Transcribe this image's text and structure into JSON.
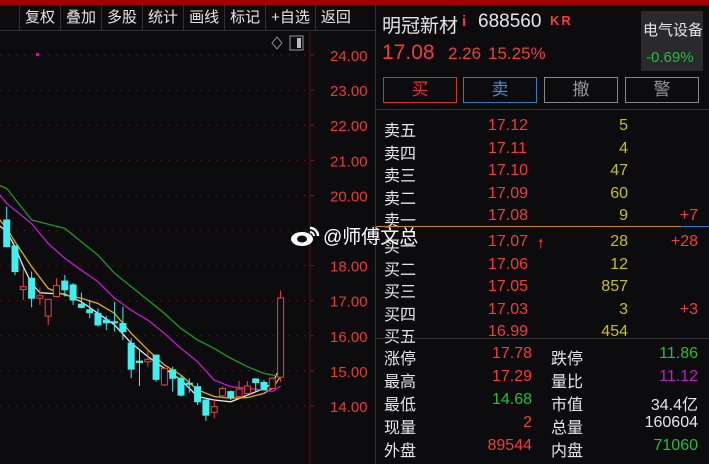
{
  "toolbar": [
    "复权",
    "叠加",
    "多股",
    "统计",
    "画线",
    "标记",
    "+自选",
    "返回"
  ],
  "stock": {
    "name": "明冠新材",
    "info_mark": "i",
    "code": "688560",
    "tag": "KR",
    "price": "17.08",
    "change": "2.26",
    "pct": "15.25%"
  },
  "sector": {
    "name": "电气设备",
    "pct": "-0.69%"
  },
  "actions": {
    "buy": "买",
    "sell": "卖",
    "cancel": "撤",
    "alert": "警"
  },
  "asks": [
    {
      "label": "卖五",
      "price": "17.12",
      "vol": "5",
      "chg": ""
    },
    {
      "label": "卖四",
      "price": "17.11",
      "vol": "4",
      "chg": ""
    },
    {
      "label": "卖三",
      "price": "17.10",
      "vol": "47",
      "chg": ""
    },
    {
      "label": "卖二",
      "price": "17.09",
      "vol": "60",
      "chg": ""
    },
    {
      "label": "卖一",
      "price": "17.08",
      "vol": "9",
      "chg": "+7"
    }
  ],
  "bids": [
    {
      "label": "买一",
      "price": "17.07",
      "vol": "28",
      "chg": "+28"
    },
    {
      "label": "买二",
      "price": "17.06",
      "vol": "12",
      "chg": ""
    },
    {
      "label": "买三",
      "price": "17.05",
      "vol": "857",
      "chg": ""
    },
    {
      "label": "买四",
      "price": "17.03",
      "vol": "3",
      "chg": "+3"
    },
    {
      "label": "买五",
      "price": "16.99",
      "vol": "454",
      "chg": ""
    }
  ],
  "stats": [
    {
      "l1": "涨停",
      "v1": "17.78",
      "c1": "red",
      "l2": "跌停",
      "v2": "11.86",
      "c2": "green"
    },
    {
      "l1": "最高",
      "v1": "17.29",
      "c1": "red",
      "l2": "量比",
      "v2": "11.12",
      "c2": "pur"
    },
    {
      "l1": "最低",
      "v1": "14.68",
      "c1": "green",
      "l2": "市值",
      "v2": "34.4亿",
      "c2": "wht"
    },
    {
      "l1": "现量",
      "v1": "2",
      "c1": "red",
      "l2": "总量",
      "v2": "160604",
      "c2": "wht"
    },
    {
      "l1": "外盘",
      "v1": "89544",
      "c1": "red",
      "l2": "内盘",
      "v2": "71060",
      "c2": "green"
    }
  ],
  "watermark": "@师傅文总",
  "colors": {
    "up": "#f23c3c",
    "down": "#3ef0f0",
    "ma5": "#e6e6e6",
    "ma10": "#e0b000",
    "ma20": "#c21cc8",
    "ma30": "#1a9e1a"
  },
  "chart_data": {
    "type": "candlestick",
    "yticks": [
      "24.00",
      "23.00",
      "22.00",
      "21.00",
      "20.00",
      "18.00",
      "17.00",
      "16.00",
      "15.00",
      "14.00"
    ],
    "ylim": [
      13.5,
      24.7
    ],
    "candles": [
      [
        19.3,
        18.54,
        19.68,
        18.52
      ],
      [
        18.56,
        17.83,
        18.56,
        17.73
      ],
      [
        17.32,
        17.4,
        17.92,
        17.02
      ],
      [
        17.64,
        17.07,
        17.83,
        16.81
      ],
      [
        17.07,
        17.14,
        17.38,
        16.88
      ],
      [
        16.56,
        17.04,
        17.04,
        16.31
      ],
      [
        17.12,
        17.43,
        17.64,
        17.09
      ],
      [
        17.56,
        17.31,
        17.73,
        17.12
      ],
      [
        17.45,
        17.02,
        17.5,
        16.88
      ],
      [
        16.9,
        16.81,
        17.23,
        16.78
      ],
      [
        16.74,
        16.66,
        17.02,
        16.5
      ],
      [
        16.64,
        16.31,
        16.78,
        16.26
      ],
      [
        16.45,
        16.37,
        16.57,
        16.17
      ],
      [
        16.4,
        16.37,
        16.97,
        16.12
      ],
      [
        16.35,
        16.12,
        16.83,
        15.88
      ],
      [
        15.79,
        15.05,
        15.93,
        14.79
      ],
      [
        15.28,
        15.24,
        15.6,
        14.57
      ],
      [
        15.26,
        15.33,
        15.6,
        15.12
      ],
      [
        15.45,
        14.76,
        15.45,
        14.69
      ],
      [
        14.6,
        15.07,
        15.12,
        14.57
      ],
      [
        15.03,
        14.79,
        15.12,
        14.41
      ],
      [
        14.79,
        14.31,
        14.88,
        14.27
      ],
      [
        14.65,
        14.62,
        14.79,
        14.38
      ],
      [
        14.55,
        14.12,
        14.65,
        14.03
      ],
      [
        14.17,
        13.74,
        14.19,
        13.58
      ],
      [
        13.82,
        13.98,
        14.17,
        13.65
      ],
      [
        14.29,
        14.5,
        14.55,
        14.27
      ],
      [
        14.41,
        14.25,
        14.44,
        14.17
      ],
      [
        14.27,
        14.48,
        14.72,
        14.24
      ],
      [
        14.36,
        14.57,
        14.71,
        14.31
      ],
      [
        14.77,
        14.67,
        14.79,
        14.41
      ],
      [
        14.67,
        14.46,
        14.74,
        14.44
      ],
      [
        14.5,
        14.79,
        14.82,
        14.48
      ],
      [
        14.82,
        17.08,
        17.29,
        14.68
      ]
    ],
    "ma": [
      {
        "name": "ma5",
        "pts": [
          [
            -1,
            19.16
          ],
          [
            0,
            18.97
          ],
          [
            1,
            18.54
          ],
          [
            2,
            17.97
          ],
          [
            3,
            17.49
          ],
          [
            4,
            17.23
          ],
          [
            5,
            17.21
          ],
          [
            7,
            17.19
          ],
          [
            9,
            16.97
          ],
          [
            11,
            16.64
          ],
          [
            13,
            16.31
          ],
          [
            15,
            15.79
          ],
          [
            17,
            15.41
          ],
          [
            19,
            15.07
          ],
          [
            21,
            14.74
          ],
          [
            23,
            14.27
          ],
          [
            25,
            14.17
          ],
          [
            27,
            14.12
          ],
          [
            29,
            14.31
          ],
          [
            31,
            14.5
          ],
          [
            32,
            14.65
          ],
          [
            33,
            15.12
          ]
        ]
      },
      {
        "name": "ma10",
        "pts": [
          [
            -1,
            19.35
          ],
          [
            0,
            19.06
          ],
          [
            1,
            18.68
          ],
          [
            3,
            17.97
          ],
          [
            5,
            17.35
          ],
          [
            7,
            17.16
          ],
          [
            9,
            17.07
          ],
          [
            11,
            16.92
          ],
          [
            13,
            16.64
          ],
          [
            15,
            16.07
          ],
          [
            17,
            15.6
          ],
          [
            19,
            15.17
          ],
          [
            21,
            14.88
          ],
          [
            23,
            14.46
          ],
          [
            25,
            14.27
          ],
          [
            27,
            14.22
          ],
          [
            29,
            14.24
          ],
          [
            31,
            14.36
          ],
          [
            32,
            14.5
          ],
          [
            33,
            14.84
          ]
        ]
      },
      {
        "name": "ma20",
        "pts": [
          [
            -1,
            20.06
          ],
          [
            0,
            19.77
          ],
          [
            3,
            19.2
          ],
          [
            5,
            18.63
          ],
          [
            7,
            18.21
          ],
          [
            9,
            17.87
          ],
          [
            11,
            17.54
          ],
          [
            13,
            17.07
          ],
          [
            15,
            16.73
          ],
          [
            17,
            16.45
          ],
          [
            19,
            16.07
          ],
          [
            21,
            15.64
          ],
          [
            23,
            15.26
          ],
          [
            25,
            14.74
          ],
          [
            27,
            14.55
          ],
          [
            29,
            14.5
          ],
          [
            31,
            14.46
          ],
          [
            32,
            14.41
          ],
          [
            33,
            14.57
          ]
        ]
      },
      {
        "name": "ma30",
        "pts": [
          [
            -1,
            20.3
          ],
          [
            0,
            20.2
          ],
          [
            3,
            19.3
          ],
          [
            7,
            19.06
          ],
          [
            9,
            18.68
          ],
          [
            11,
            18.3
          ],
          [
            13,
            17.78
          ],
          [
            15,
            17.4
          ],
          [
            17,
            17.02
          ],
          [
            19,
            16.64
          ],
          [
            21,
            16.21
          ],
          [
            23,
            15.88
          ],
          [
            25,
            15.64
          ],
          [
            27,
            15.36
          ],
          [
            29,
            15.12
          ],
          [
            31,
            14.93
          ],
          [
            33,
            14.84
          ]
        ]
      }
    ]
  }
}
